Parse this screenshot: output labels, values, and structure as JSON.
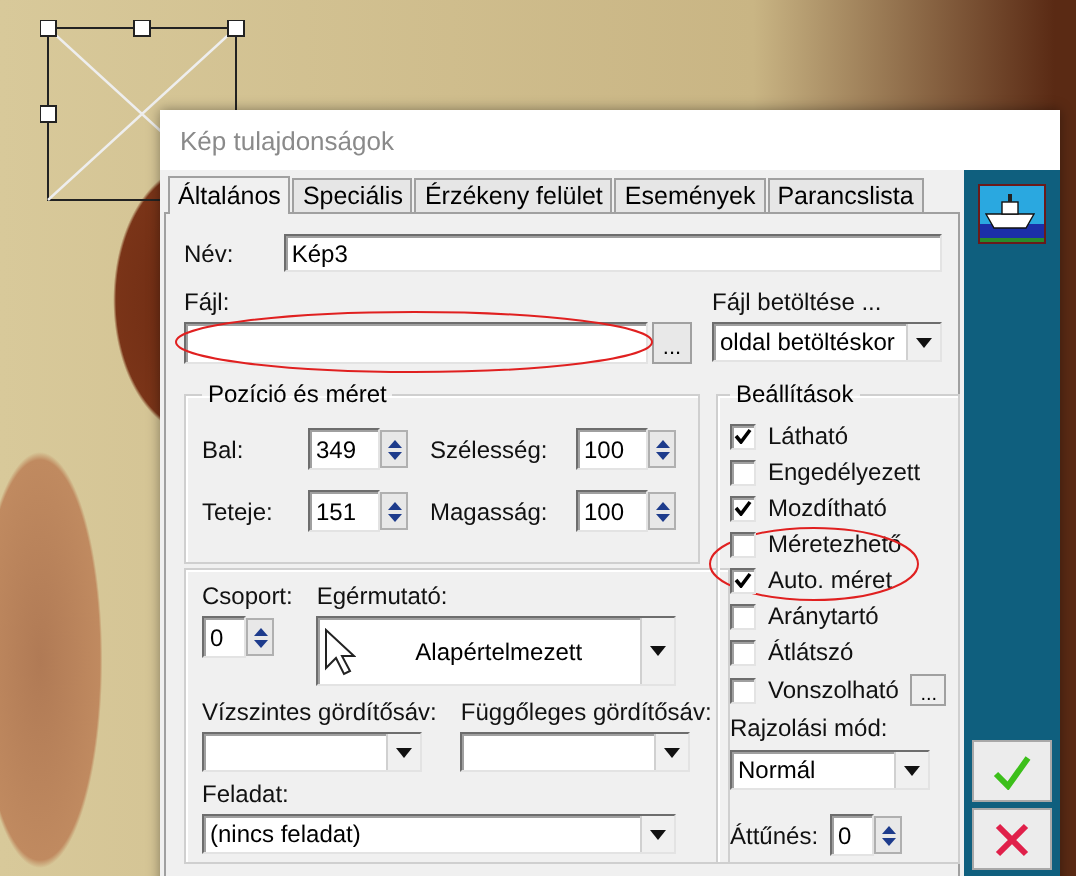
{
  "window": {
    "title": "Kép tulajdonságok"
  },
  "tabs": [
    {
      "label": "Általános",
      "selected": true
    },
    {
      "label": "Speciális",
      "selected": false
    },
    {
      "label": "Érzékeny felület",
      "selected": false
    },
    {
      "label": "Események",
      "selected": false
    },
    {
      "label": "Parancslista",
      "selected": false
    }
  ],
  "name": {
    "label": "Név:",
    "value": "Kép3"
  },
  "file": {
    "label": "Fájl:",
    "browse": "..."
  },
  "file_loading": {
    "label": "Fájl betöltése ...",
    "value": "oldal betöltéskor"
  },
  "position_size": {
    "title": "Pozíció és méret",
    "fields": [
      {
        "label": "Bal:",
        "value": "349"
      },
      {
        "label": "Szélesség:",
        "value": "100"
      },
      {
        "label": "Teteje:",
        "value": "151"
      },
      {
        "label": "Magasság:",
        "value": "100"
      }
    ]
  },
  "group": {
    "label": "Csoport:",
    "value": "0"
  },
  "cursor": {
    "label": "Egérmutató:",
    "value": "Alapértelmezett"
  },
  "h_scroll": {
    "label": "Vízszintes gördítősáv:"
  },
  "v_scroll": {
    "label": "Függőleges gördítősáv:"
  },
  "task": {
    "label": "Feladat:",
    "value": "(nincs feladat)"
  },
  "settings": {
    "title": "Beállítások",
    "options": [
      {
        "label": "Látható",
        "checked": true
      },
      {
        "label": "Engedélyezett",
        "checked": false
      },
      {
        "label": "Mozdítható",
        "checked": true
      },
      {
        "label": "Méretezhető",
        "checked": false
      },
      {
        "label": "Auto. méret",
        "checked": true
      },
      {
        "label": "Aránytartó",
        "checked": false
      },
      {
        "label": "Átlátszó",
        "checked": false
      },
      {
        "label": "Vonszolható",
        "checked": false,
        "button": "..."
      }
    ]
  },
  "draw_mode": {
    "label": "Rajzolási mód:",
    "value": "Normál"
  },
  "fade": {
    "label": "Áttűnés:",
    "value": "0"
  }
}
